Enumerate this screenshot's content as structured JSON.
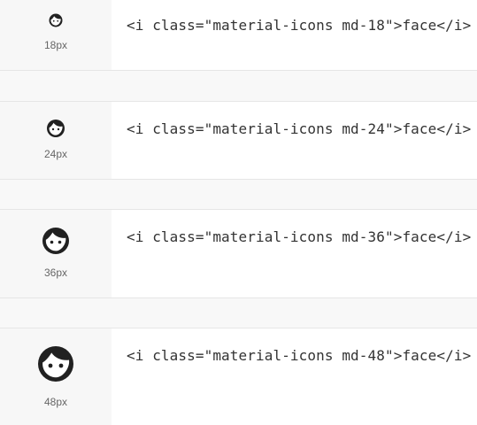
{
  "rows": [
    {
      "icon": "face-icon",
      "size_label": "18px",
      "code": "<i class=\"material-icons md-18\">face</i>"
    },
    {
      "icon": "face-icon",
      "size_label": "24px",
      "code": "<i class=\"material-icons md-24\">face</i>"
    },
    {
      "icon": "face-icon",
      "size_label": "36px",
      "code": "<i class=\"material-icons md-36\">face</i>"
    },
    {
      "icon": "face-icon",
      "size_label": "48px",
      "code": "<i class=\"material-icons md-48\">face</i>"
    }
  ],
  "colors": {
    "icon": "#212121",
    "code_text": "#333333",
    "label_text": "#666666",
    "preview_bg": "#f7f7f7",
    "gap_bg": "#f8f8f8"
  }
}
